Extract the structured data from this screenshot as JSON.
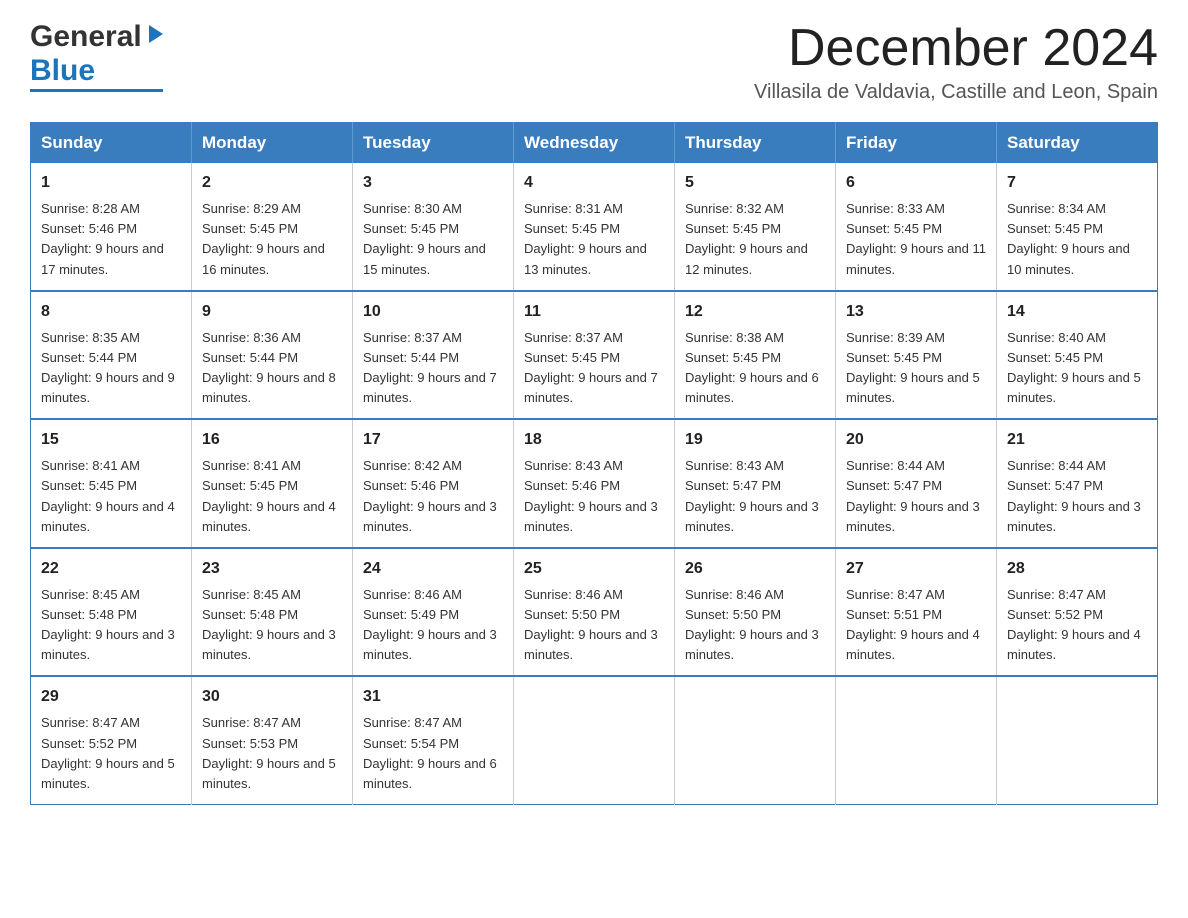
{
  "header": {
    "logo": {
      "general": "General",
      "blue": "Blue"
    },
    "month_title": "December 2024",
    "subtitle": "Villasila de Valdavia, Castille and Leon, Spain"
  },
  "days_of_week": [
    "Sunday",
    "Monday",
    "Tuesday",
    "Wednesday",
    "Thursday",
    "Friday",
    "Saturday"
  ],
  "weeks": [
    [
      {
        "day": "1",
        "sunrise": "Sunrise: 8:28 AM",
        "sunset": "Sunset: 5:46 PM",
        "daylight": "Daylight: 9 hours and 17 minutes."
      },
      {
        "day": "2",
        "sunrise": "Sunrise: 8:29 AM",
        "sunset": "Sunset: 5:45 PM",
        "daylight": "Daylight: 9 hours and 16 minutes."
      },
      {
        "day": "3",
        "sunrise": "Sunrise: 8:30 AM",
        "sunset": "Sunset: 5:45 PM",
        "daylight": "Daylight: 9 hours and 15 minutes."
      },
      {
        "day": "4",
        "sunrise": "Sunrise: 8:31 AM",
        "sunset": "Sunset: 5:45 PM",
        "daylight": "Daylight: 9 hours and 13 minutes."
      },
      {
        "day": "5",
        "sunrise": "Sunrise: 8:32 AM",
        "sunset": "Sunset: 5:45 PM",
        "daylight": "Daylight: 9 hours and 12 minutes."
      },
      {
        "day": "6",
        "sunrise": "Sunrise: 8:33 AM",
        "sunset": "Sunset: 5:45 PM",
        "daylight": "Daylight: 9 hours and 11 minutes."
      },
      {
        "day": "7",
        "sunrise": "Sunrise: 8:34 AM",
        "sunset": "Sunset: 5:45 PM",
        "daylight": "Daylight: 9 hours and 10 minutes."
      }
    ],
    [
      {
        "day": "8",
        "sunrise": "Sunrise: 8:35 AM",
        "sunset": "Sunset: 5:44 PM",
        "daylight": "Daylight: 9 hours and 9 minutes."
      },
      {
        "day": "9",
        "sunrise": "Sunrise: 8:36 AM",
        "sunset": "Sunset: 5:44 PM",
        "daylight": "Daylight: 9 hours and 8 minutes."
      },
      {
        "day": "10",
        "sunrise": "Sunrise: 8:37 AM",
        "sunset": "Sunset: 5:44 PM",
        "daylight": "Daylight: 9 hours and 7 minutes."
      },
      {
        "day": "11",
        "sunrise": "Sunrise: 8:37 AM",
        "sunset": "Sunset: 5:45 PM",
        "daylight": "Daylight: 9 hours and 7 minutes."
      },
      {
        "day": "12",
        "sunrise": "Sunrise: 8:38 AM",
        "sunset": "Sunset: 5:45 PM",
        "daylight": "Daylight: 9 hours and 6 minutes."
      },
      {
        "day": "13",
        "sunrise": "Sunrise: 8:39 AM",
        "sunset": "Sunset: 5:45 PM",
        "daylight": "Daylight: 9 hours and 5 minutes."
      },
      {
        "day": "14",
        "sunrise": "Sunrise: 8:40 AM",
        "sunset": "Sunset: 5:45 PM",
        "daylight": "Daylight: 9 hours and 5 minutes."
      }
    ],
    [
      {
        "day": "15",
        "sunrise": "Sunrise: 8:41 AM",
        "sunset": "Sunset: 5:45 PM",
        "daylight": "Daylight: 9 hours and 4 minutes."
      },
      {
        "day": "16",
        "sunrise": "Sunrise: 8:41 AM",
        "sunset": "Sunset: 5:45 PM",
        "daylight": "Daylight: 9 hours and 4 minutes."
      },
      {
        "day": "17",
        "sunrise": "Sunrise: 8:42 AM",
        "sunset": "Sunset: 5:46 PM",
        "daylight": "Daylight: 9 hours and 3 minutes."
      },
      {
        "day": "18",
        "sunrise": "Sunrise: 8:43 AM",
        "sunset": "Sunset: 5:46 PM",
        "daylight": "Daylight: 9 hours and 3 minutes."
      },
      {
        "day": "19",
        "sunrise": "Sunrise: 8:43 AM",
        "sunset": "Sunset: 5:47 PM",
        "daylight": "Daylight: 9 hours and 3 minutes."
      },
      {
        "day": "20",
        "sunrise": "Sunrise: 8:44 AM",
        "sunset": "Sunset: 5:47 PM",
        "daylight": "Daylight: 9 hours and 3 minutes."
      },
      {
        "day": "21",
        "sunrise": "Sunrise: 8:44 AM",
        "sunset": "Sunset: 5:47 PM",
        "daylight": "Daylight: 9 hours and 3 minutes."
      }
    ],
    [
      {
        "day": "22",
        "sunrise": "Sunrise: 8:45 AM",
        "sunset": "Sunset: 5:48 PM",
        "daylight": "Daylight: 9 hours and 3 minutes."
      },
      {
        "day": "23",
        "sunrise": "Sunrise: 8:45 AM",
        "sunset": "Sunset: 5:48 PM",
        "daylight": "Daylight: 9 hours and 3 minutes."
      },
      {
        "day": "24",
        "sunrise": "Sunrise: 8:46 AM",
        "sunset": "Sunset: 5:49 PM",
        "daylight": "Daylight: 9 hours and 3 minutes."
      },
      {
        "day": "25",
        "sunrise": "Sunrise: 8:46 AM",
        "sunset": "Sunset: 5:50 PM",
        "daylight": "Daylight: 9 hours and 3 minutes."
      },
      {
        "day": "26",
        "sunrise": "Sunrise: 8:46 AM",
        "sunset": "Sunset: 5:50 PM",
        "daylight": "Daylight: 9 hours and 3 minutes."
      },
      {
        "day": "27",
        "sunrise": "Sunrise: 8:47 AM",
        "sunset": "Sunset: 5:51 PM",
        "daylight": "Daylight: 9 hours and 4 minutes."
      },
      {
        "day": "28",
        "sunrise": "Sunrise: 8:47 AM",
        "sunset": "Sunset: 5:52 PM",
        "daylight": "Daylight: 9 hours and 4 minutes."
      }
    ],
    [
      {
        "day": "29",
        "sunrise": "Sunrise: 8:47 AM",
        "sunset": "Sunset: 5:52 PM",
        "daylight": "Daylight: 9 hours and 5 minutes."
      },
      {
        "day": "30",
        "sunrise": "Sunrise: 8:47 AM",
        "sunset": "Sunset: 5:53 PM",
        "daylight": "Daylight: 9 hours and 5 minutes."
      },
      {
        "day": "31",
        "sunrise": "Sunrise: 8:47 AM",
        "sunset": "Sunset: 5:54 PM",
        "daylight": "Daylight: 9 hours and 6 minutes."
      },
      null,
      null,
      null,
      null
    ]
  ]
}
